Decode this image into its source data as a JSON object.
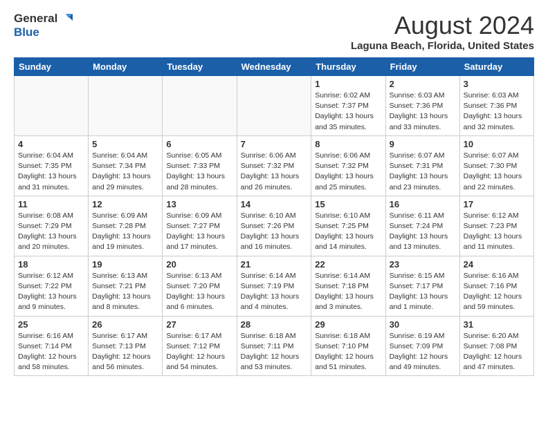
{
  "header": {
    "logo_line1": "General",
    "logo_line2": "Blue",
    "main_title": "August 2024",
    "subtitle": "Laguna Beach, Florida, United States"
  },
  "days_of_week": [
    "Sunday",
    "Monday",
    "Tuesday",
    "Wednesday",
    "Thursday",
    "Friday",
    "Saturday"
  ],
  "weeks": [
    [
      {
        "day": "",
        "info": ""
      },
      {
        "day": "",
        "info": ""
      },
      {
        "day": "",
        "info": ""
      },
      {
        "day": "",
        "info": ""
      },
      {
        "day": "1",
        "info": "Sunrise: 6:02 AM\nSunset: 7:37 PM\nDaylight: 13 hours\nand 35 minutes."
      },
      {
        "day": "2",
        "info": "Sunrise: 6:03 AM\nSunset: 7:36 PM\nDaylight: 13 hours\nand 33 minutes."
      },
      {
        "day": "3",
        "info": "Sunrise: 6:03 AM\nSunset: 7:36 PM\nDaylight: 13 hours\nand 32 minutes."
      }
    ],
    [
      {
        "day": "4",
        "info": "Sunrise: 6:04 AM\nSunset: 7:35 PM\nDaylight: 13 hours\nand 31 minutes."
      },
      {
        "day": "5",
        "info": "Sunrise: 6:04 AM\nSunset: 7:34 PM\nDaylight: 13 hours\nand 29 minutes."
      },
      {
        "day": "6",
        "info": "Sunrise: 6:05 AM\nSunset: 7:33 PM\nDaylight: 13 hours\nand 28 minutes."
      },
      {
        "day": "7",
        "info": "Sunrise: 6:06 AM\nSunset: 7:32 PM\nDaylight: 13 hours\nand 26 minutes."
      },
      {
        "day": "8",
        "info": "Sunrise: 6:06 AM\nSunset: 7:32 PM\nDaylight: 13 hours\nand 25 minutes."
      },
      {
        "day": "9",
        "info": "Sunrise: 6:07 AM\nSunset: 7:31 PM\nDaylight: 13 hours\nand 23 minutes."
      },
      {
        "day": "10",
        "info": "Sunrise: 6:07 AM\nSunset: 7:30 PM\nDaylight: 13 hours\nand 22 minutes."
      }
    ],
    [
      {
        "day": "11",
        "info": "Sunrise: 6:08 AM\nSunset: 7:29 PM\nDaylight: 13 hours\nand 20 minutes."
      },
      {
        "day": "12",
        "info": "Sunrise: 6:09 AM\nSunset: 7:28 PM\nDaylight: 13 hours\nand 19 minutes."
      },
      {
        "day": "13",
        "info": "Sunrise: 6:09 AM\nSunset: 7:27 PM\nDaylight: 13 hours\nand 17 minutes."
      },
      {
        "day": "14",
        "info": "Sunrise: 6:10 AM\nSunset: 7:26 PM\nDaylight: 13 hours\nand 16 minutes."
      },
      {
        "day": "15",
        "info": "Sunrise: 6:10 AM\nSunset: 7:25 PM\nDaylight: 13 hours\nand 14 minutes."
      },
      {
        "day": "16",
        "info": "Sunrise: 6:11 AM\nSunset: 7:24 PM\nDaylight: 13 hours\nand 13 minutes."
      },
      {
        "day": "17",
        "info": "Sunrise: 6:12 AM\nSunset: 7:23 PM\nDaylight: 13 hours\nand 11 minutes."
      }
    ],
    [
      {
        "day": "18",
        "info": "Sunrise: 6:12 AM\nSunset: 7:22 PM\nDaylight: 13 hours\nand 9 minutes."
      },
      {
        "day": "19",
        "info": "Sunrise: 6:13 AM\nSunset: 7:21 PM\nDaylight: 13 hours\nand 8 minutes."
      },
      {
        "day": "20",
        "info": "Sunrise: 6:13 AM\nSunset: 7:20 PM\nDaylight: 13 hours\nand 6 minutes."
      },
      {
        "day": "21",
        "info": "Sunrise: 6:14 AM\nSunset: 7:19 PM\nDaylight: 13 hours\nand 4 minutes."
      },
      {
        "day": "22",
        "info": "Sunrise: 6:14 AM\nSunset: 7:18 PM\nDaylight: 13 hours\nand 3 minutes."
      },
      {
        "day": "23",
        "info": "Sunrise: 6:15 AM\nSunset: 7:17 PM\nDaylight: 13 hours\nand 1 minute."
      },
      {
        "day": "24",
        "info": "Sunrise: 6:16 AM\nSunset: 7:16 PM\nDaylight: 12 hours\nand 59 minutes."
      }
    ],
    [
      {
        "day": "25",
        "info": "Sunrise: 6:16 AM\nSunset: 7:14 PM\nDaylight: 12 hours\nand 58 minutes."
      },
      {
        "day": "26",
        "info": "Sunrise: 6:17 AM\nSunset: 7:13 PM\nDaylight: 12 hours\nand 56 minutes."
      },
      {
        "day": "27",
        "info": "Sunrise: 6:17 AM\nSunset: 7:12 PM\nDaylight: 12 hours\nand 54 minutes."
      },
      {
        "day": "28",
        "info": "Sunrise: 6:18 AM\nSunset: 7:11 PM\nDaylight: 12 hours\nand 53 minutes."
      },
      {
        "day": "29",
        "info": "Sunrise: 6:18 AM\nSunset: 7:10 PM\nDaylight: 12 hours\nand 51 minutes."
      },
      {
        "day": "30",
        "info": "Sunrise: 6:19 AM\nSunset: 7:09 PM\nDaylight: 12 hours\nand 49 minutes."
      },
      {
        "day": "31",
        "info": "Sunrise: 6:20 AM\nSunset: 7:08 PM\nDaylight: 12 hours\nand 47 minutes."
      }
    ]
  ]
}
